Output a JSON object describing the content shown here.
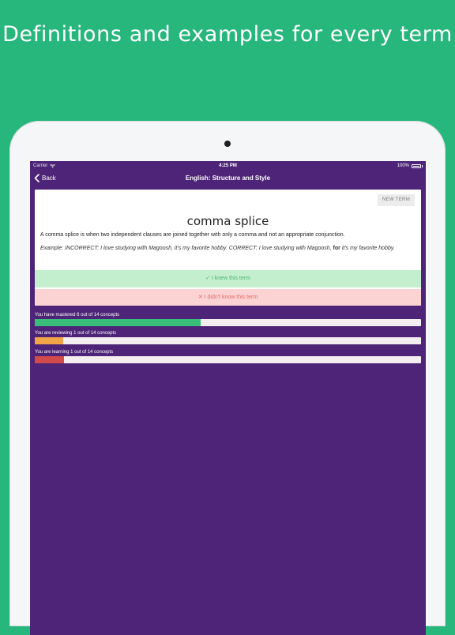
{
  "headline": "Definitions and examples for every term",
  "status_bar": {
    "carrier": "Carrier",
    "time": "4:25 PM",
    "battery": "100%"
  },
  "nav": {
    "back_label": "Back",
    "title": "English: Structure and Style"
  },
  "card": {
    "new_term_label": "NEW TERM",
    "term": "comma splice",
    "definition": "A comma splice is when two independent clauses are joined together with only a comma and not an appropriate conjunction.",
    "example_prefix": "Example: INCORRECT: I love studying with Magoosh, it's my favorite hobby. CORRECT: I love studying with Magoosh, ",
    "example_bold": "for",
    "example_suffix": " it's my favorite hobby.",
    "knew_label": "✓ I knew this term",
    "didnt_label": "✕ I didn't know this term"
  },
  "progress": [
    {
      "label": "You have mastered 6 out of 14 concepts",
      "value": 6,
      "total": 14,
      "color": "#3bbd7a"
    },
    {
      "label": "You are reviewing 1 out of 14 concepts",
      "value": 1,
      "total": 14,
      "color": "#f2a548"
    },
    {
      "label": "You are learning 1 out of 14 concepts",
      "value": 1,
      "total": 14,
      "color": "#d24b4b"
    }
  ],
  "colors": {
    "background": "#27b67c",
    "screen": "#4d2477",
    "knew_bg": "#c3efcf",
    "didnt_bg": "#fbd3d3"
  }
}
